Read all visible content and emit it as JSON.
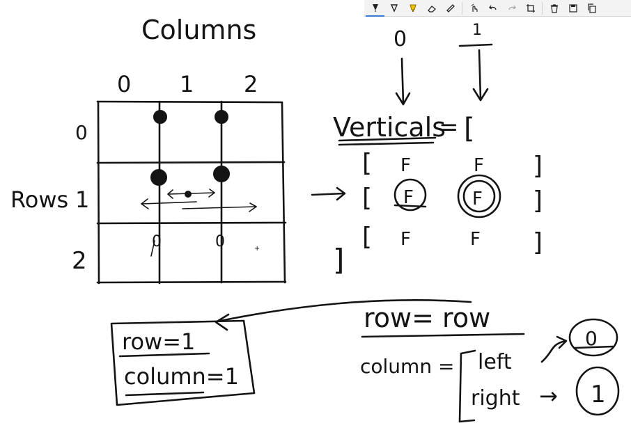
{
  "toolbar": {
    "tools": [
      {
        "icon": "ballpoint-pen-icon",
        "active": true
      },
      {
        "icon": "pencil-pen-icon",
        "active": false
      },
      {
        "icon": "highlighter-icon",
        "active": false,
        "color": "#f2c200"
      },
      {
        "icon": "eraser-icon",
        "active": false
      },
      {
        "icon": "ruler-icon",
        "active": false
      },
      {
        "icon": "touch-writing-icon",
        "active": false
      },
      {
        "icon": "undo-icon",
        "active": false
      },
      {
        "icon": "redo-icon",
        "active": false
      },
      {
        "icon": "crop-icon",
        "active": false
      },
      {
        "icon": "delete-icon",
        "active": false
      },
      {
        "icon": "save-icon",
        "active": false
      },
      {
        "icon": "copy-icon",
        "active": false
      }
    ]
  },
  "notes": {
    "columns_title": "Columns",
    "column_indices": [
      "0",
      "1",
      "2"
    ],
    "rows_title": "Rows",
    "row_indices": [
      "0",
      "1",
      "2"
    ],
    "verticals_label": "Verticals",
    "equals": "=",
    "open_bracket": "[",
    "close_bracket": "]",
    "arrow_top_labels": [
      "0",
      "1"
    ],
    "matrix_rows": [
      [
        "F",
        "F"
      ],
      [
        "F",
        "F"
      ],
      [
        "F",
        "F"
      ]
    ],
    "selected_row": "row=1",
    "selected_column": "column=1",
    "row_eq_row": "row= row",
    "column_eq": "column =",
    "left": "left",
    "right": "right",
    "left_result": "0",
    "right_result": "1",
    "arrow_glyph": "→",
    "cell_zero_left": "0",
    "cell_zero_right": "0"
  },
  "colors": {
    "ink": "#141414",
    "toolbar_bg": "#f3f3f3",
    "accent": "#3a7bd5"
  }
}
